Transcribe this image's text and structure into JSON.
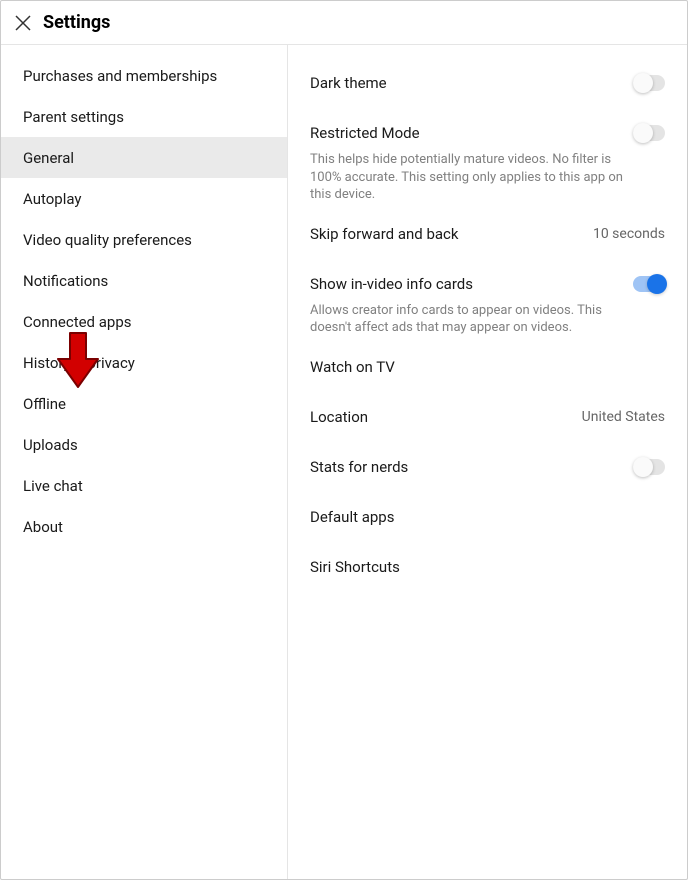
{
  "header": {
    "title": "Settings"
  },
  "sidebar": {
    "items": [
      {
        "label": "Purchases and memberships"
      },
      {
        "label": "Parent settings"
      },
      {
        "label": "General"
      },
      {
        "label": "Autoplay"
      },
      {
        "label": "Video quality preferences"
      },
      {
        "label": "Notifications"
      },
      {
        "label": "Connected apps"
      },
      {
        "label": "History & privacy"
      },
      {
        "label": "Offline"
      },
      {
        "label": "Uploads"
      },
      {
        "label": "Live chat"
      },
      {
        "label": "About"
      }
    ],
    "selectedIndex": 2
  },
  "main": {
    "darkTheme": {
      "label": "Dark theme"
    },
    "restrictedMode": {
      "label": "Restricted Mode",
      "desc": "This helps hide potentially mature videos. No filter is 100% accurate. This setting only applies to this app on this device."
    },
    "skip": {
      "label": "Skip forward and back",
      "value": "10 seconds"
    },
    "infoCards": {
      "label": "Show in-video info cards",
      "desc": "Allows creator info cards to appear on videos. This doesn't affect ads that may appear on videos."
    },
    "watchOnTv": {
      "label": "Watch on TV"
    },
    "location": {
      "label": "Location",
      "value": "United States"
    },
    "stats": {
      "label": "Stats for nerds"
    },
    "defaultApps": {
      "label": "Default apps"
    },
    "siri": {
      "label": "Siri Shortcuts"
    }
  },
  "colors": {
    "accent": "#1a73e8",
    "arrow": "#d20000"
  }
}
